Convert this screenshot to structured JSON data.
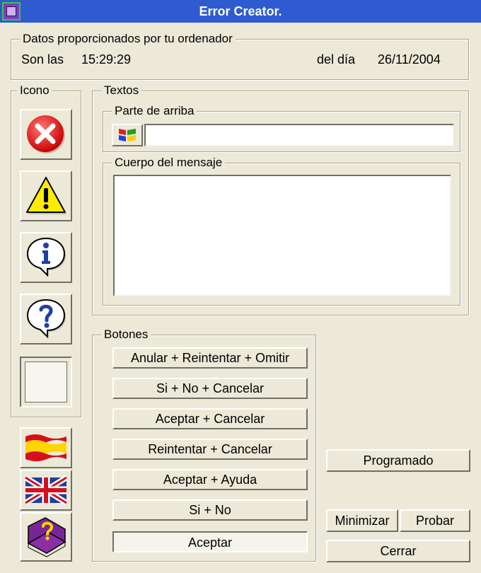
{
  "window": {
    "title": "Error Creator."
  },
  "datos": {
    "legend": "Datos proporcionados por tu ordenador",
    "time_label": "Son las",
    "time_value": "15:29:29",
    "date_label": "del día",
    "date_value": "26/11/2004"
  },
  "icono": {
    "legend": "Icono"
  },
  "textos": {
    "legend": "Textos",
    "top_legend": "Parte de arriba",
    "top_value": "",
    "body_legend": "Cuerpo del mensaje",
    "body_value": ""
  },
  "botones": {
    "legend": "Botones",
    "items": [
      "Anular + Reintentar + Omitir",
      "Si + No + Cancelar",
      "Aceptar + Cancelar",
      "Reintentar + Cancelar",
      "Aceptar + Ayuda",
      "Si + No",
      "Aceptar"
    ]
  },
  "actions": {
    "programado": "Programado",
    "minimizar": "Minimizar",
    "probar": "Probar",
    "cerrar": "Cerrar"
  },
  "icons": [
    "error-icon",
    "warning-icon",
    "info-icon",
    "question-icon",
    "blank-icon",
    "spanish-flag-icon",
    "english-flag-icon",
    "help-book-icon"
  ],
  "colors": {
    "titlebar": "#2f5bd1",
    "error": "#e52424",
    "warning": "#ffec00",
    "info": "#1e3fa8"
  }
}
